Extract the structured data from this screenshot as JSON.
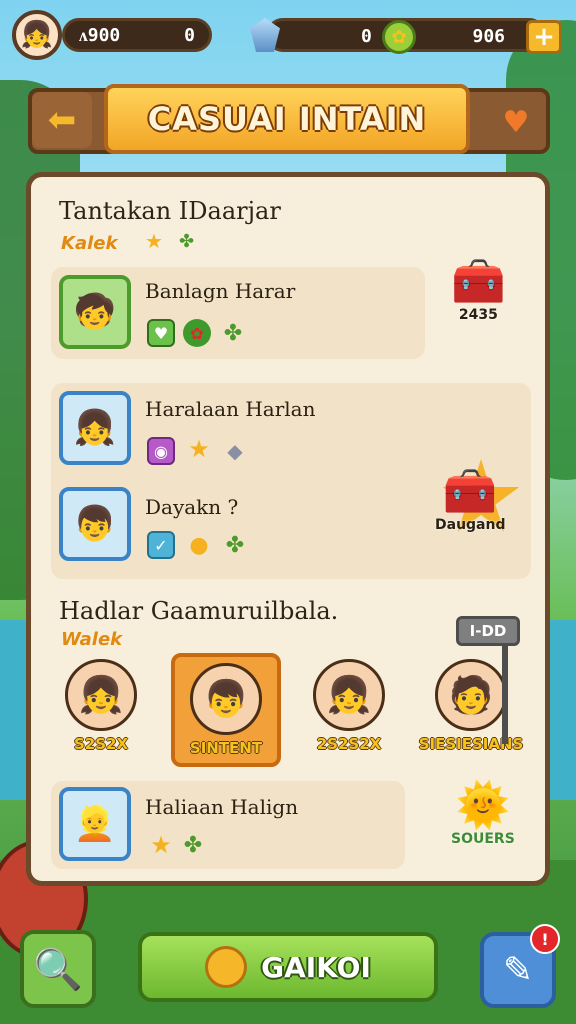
{
  "hud": {
    "coins_label": "ᴧ900",
    "coins_value": "0",
    "gems_value": "0",
    "right_value": "906",
    "plus_label": "+"
  },
  "title": {
    "text": "CASUAI INTAIN"
  },
  "sections": [
    {
      "title": "Tantakan IDaarjar",
      "subtitle": "Kalek",
      "quests": [
        {
          "name": "Banlagn Harar",
          "reward_label": "2435"
        }
      ]
    },
    {
      "quests": [
        {
          "name": "Haralaan Harlan"
        },
        {
          "name": "Dayakn ?",
          "reward_label": "Daugand"
        }
      ]
    },
    {
      "title": "Hadlar Gaamuruilbala.",
      "subtitle": "Walek",
      "sign_label": "I-DD",
      "characters": [
        {
          "name": "S2S2X"
        },
        {
          "name": "SINTENT"
        },
        {
          "name": "2S2S2X"
        },
        {
          "name": "SIESIESIANS"
        }
      ]
    },
    {
      "quests": [
        {
          "name": "Haliaan Halign",
          "reward_label": "SOUERS"
        }
      ]
    }
  ],
  "footer": {
    "go_label": "GAIKOI",
    "notif": "!"
  }
}
